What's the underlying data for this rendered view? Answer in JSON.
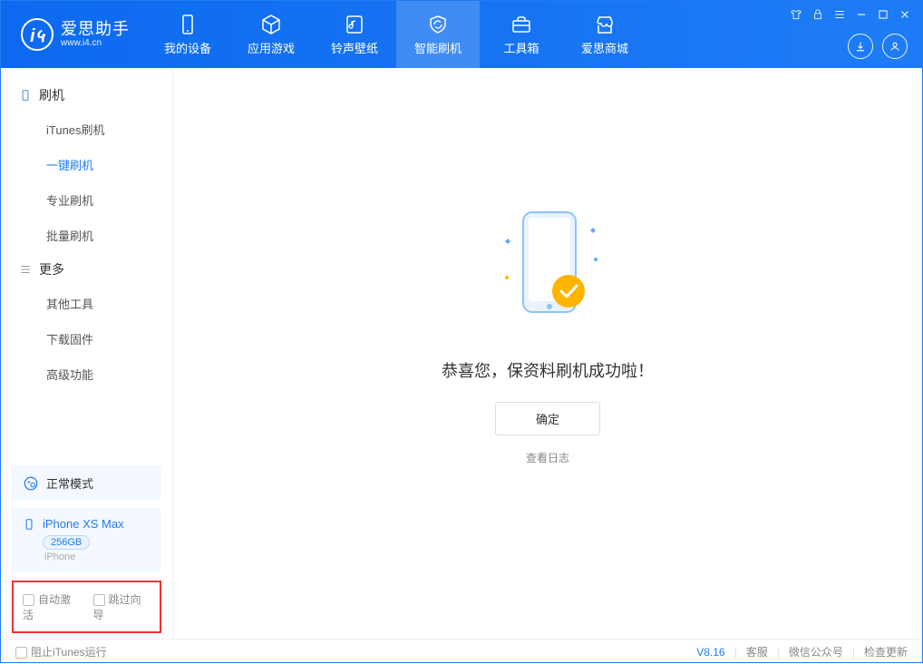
{
  "brand": {
    "name": "爱思助手",
    "url": "www.i4.cn"
  },
  "tabs": {
    "device": "我的设备",
    "apps": "应用游戏",
    "ringtone": "铃声壁纸",
    "flash": "智能刷机",
    "toolbox": "工具箱",
    "store": "爱思商城"
  },
  "sidebar": {
    "group_flash": "刷机",
    "group_more": "更多",
    "items": {
      "itunes": "iTunes刷机",
      "onekey": "一键刷机",
      "pro": "专业刷机",
      "batch": "批量刷机",
      "other": "其他工具",
      "download_fw": "下载固件",
      "advanced": "高级功能"
    },
    "mode": "正常模式",
    "device": {
      "name": "iPhone XS Max",
      "capacity": "256GB",
      "type": "iPhone"
    },
    "checkboxes": {
      "auto_activate": "自动激活",
      "skip_guide": "跳过向导"
    }
  },
  "main": {
    "message": "恭喜您，保资料刷机成功啦！",
    "ok": "确定",
    "view_log": "查看日志"
  },
  "footer": {
    "block_itunes": "阻止iTunes运行",
    "version": "V8.16",
    "service": "客服",
    "wechat": "微信公众号",
    "check_update": "检查更新"
  }
}
